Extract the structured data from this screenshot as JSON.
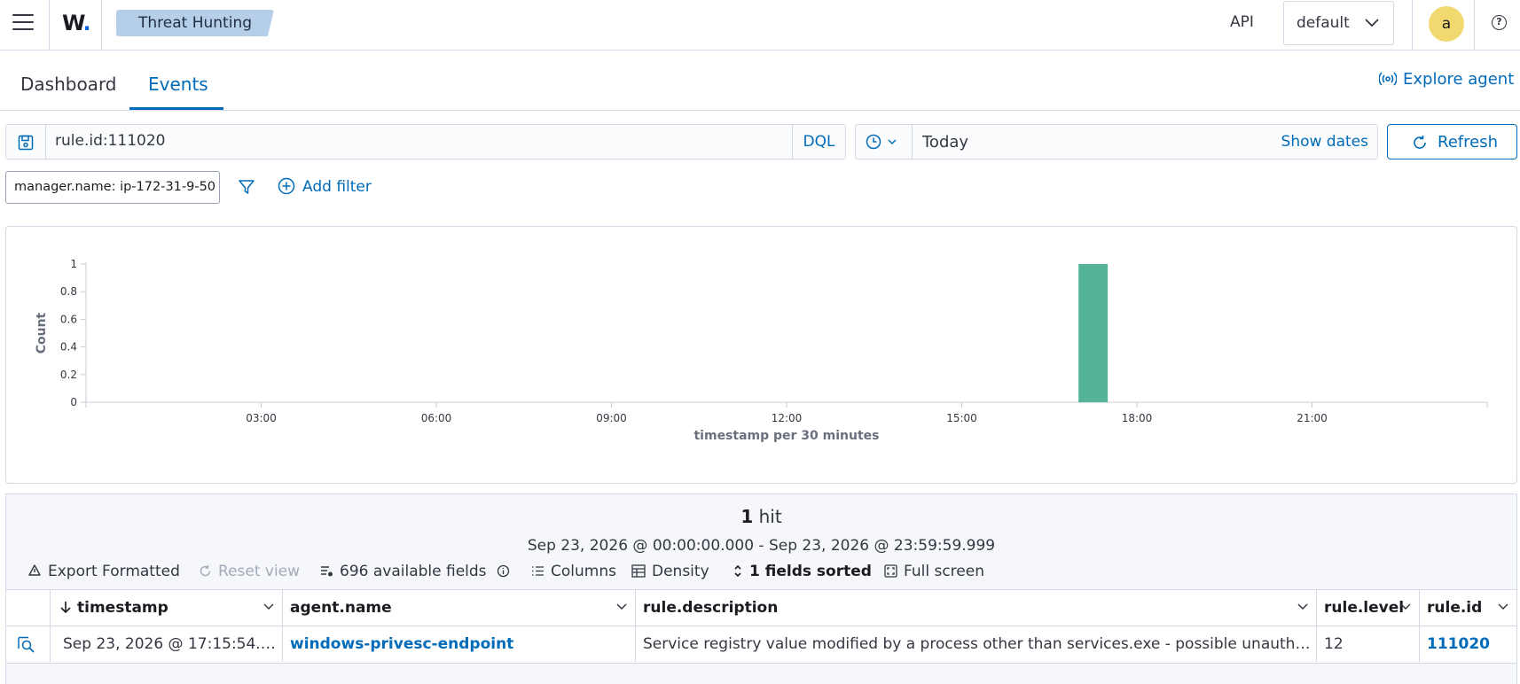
{
  "header": {
    "logo_text": "W",
    "logo_dot": ".",
    "breadcrumb": "Threat Hunting",
    "api_label": "API",
    "tenant_value": "default",
    "avatar_letter": "a",
    "help_symbol": "?"
  },
  "tabs": [
    {
      "label": "Dashboard",
      "active": false
    },
    {
      "label": "Events",
      "active": true
    }
  ],
  "explore_agent": "Explore agent",
  "search": {
    "query": "rule.id:111020",
    "language": "DQL",
    "date_value": "Today",
    "show_dates": "Show dates",
    "refresh": "Refresh"
  },
  "filters": {
    "pill": "manager.name: ip-172-31-9-50",
    "add_filter": "Add filter"
  },
  "chart_data": {
    "type": "bar",
    "xlabel": "timestamp per 30 minutes",
    "ylabel": "Count",
    "ylim": [
      0,
      1
    ],
    "yticks": [
      "0",
      "0.2",
      "0.4",
      "0.6",
      "0.8",
      "1"
    ],
    "xticks": [
      "03:00",
      "06:00",
      "09:00",
      "12:00",
      "15:00",
      "18:00",
      "21:00"
    ],
    "x_range_hours": [
      0,
      24
    ],
    "bar_width_hours": 0.5,
    "bars": [
      {
        "x": "17:00",
        "value": 1
      }
    ],
    "color": "#54b399",
    "grid": false,
    "legend": "none"
  },
  "results": {
    "hits_count": "1",
    "hits_label": "hit",
    "range": "Sep 23, 2026 @ 00:00:00.000 - Sep 23, 2026 @ 23:59:59.999",
    "toolbar": {
      "export": "Export Formatted",
      "reset": "Reset view",
      "fields": "696 available fields",
      "columns": "Columns",
      "density": "Density",
      "sorted": "1 fields sorted",
      "fullscreen": "Full screen"
    },
    "columns": [
      "timestamp",
      "agent.name",
      "rule.description",
      "rule.level",
      "rule.id"
    ],
    "rows": [
      {
        "timestamp": "Sep 23, 2026 @ 17:15:54.3...",
        "agent_name": "windows-privesc-endpoint",
        "description": "Service registry value modified by a process other than services.exe - possible unauthoriz...",
        "level": "12",
        "rule_id": "111020"
      }
    ]
  },
  "colors": {
    "accent": "#006bb8",
    "bar": "#54b399",
    "breadcrumb_bg": "#b6cfe9",
    "avatar_bg": "#f1d86f"
  }
}
